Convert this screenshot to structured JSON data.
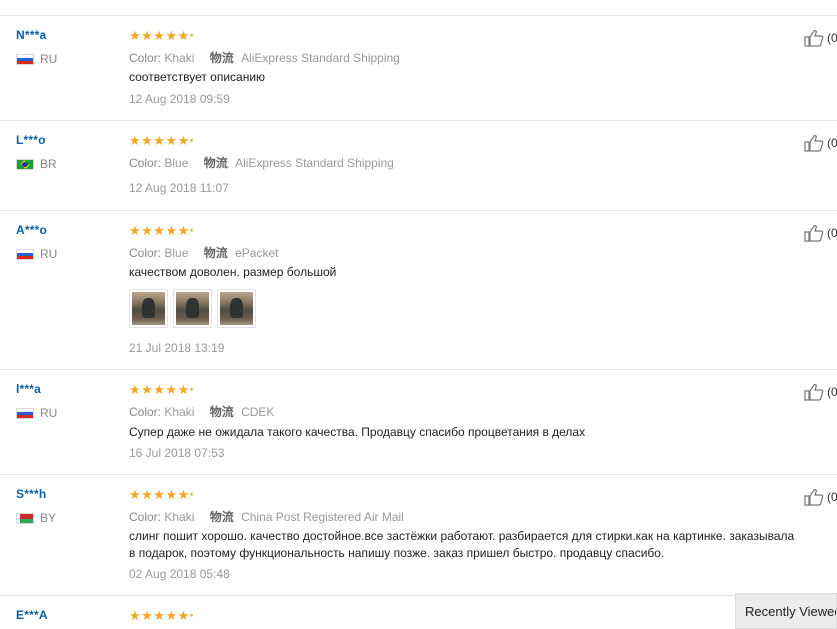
{
  "reviews": [
    {
      "user": "N***a",
      "country": "RU",
      "flag": "ru",
      "stars": "★★★★★",
      "color_label": "Color:",
      "color": "Khaki",
      "logistics_label": "物流",
      "shipping": "AliExpress Standard Shipping",
      "comment": "соответствует описанию",
      "date": "12 Aug 2018 09:59",
      "helpful": "(0"
    },
    {
      "user": "L***o",
      "country": "BR",
      "flag": "br",
      "stars": "★★★★★",
      "color_label": "Color:",
      "color": "Blue",
      "logistics_label": "物流",
      "shipping": "AliExpress Standard Shipping",
      "comment": "",
      "date": "12 Aug 2018 11:07",
      "helpful": "(0"
    },
    {
      "user": "A***o",
      "country": "RU",
      "flag": "ru",
      "stars": "★★★★★",
      "color_label": "Color:",
      "color": "Blue",
      "logistics_label": "物流",
      "shipping": "ePacket",
      "comment": "качеством доволен. размер большой",
      "photo_count": 3,
      "date": "21 Jul 2018 13:19",
      "helpful": "(0"
    },
    {
      "user": "l***a",
      "country": "RU",
      "flag": "ru",
      "stars": "★★★★★",
      "color_label": "Color:",
      "color": "Khaki",
      "logistics_label": "物流",
      "shipping": "CDEK",
      "comment": "Супер даже не ожидала такого качества. Продавцу спасибо процветания в делах",
      "date": "16 Jul 2018 07:53",
      "helpful": "(0"
    },
    {
      "user": "S***h",
      "country": "BY",
      "flag": "by",
      "stars": "★★★★★",
      "color_label": "Color:",
      "color": "Khaki",
      "logistics_label": "物流",
      "shipping": "China Post Registered Air Mail",
      "comment": "слинг пошит хорошо. качество достойное.все застёжки работают. разбирается для стирки.как на картинке. заказывала",
      "comment_line2": "в подарок, поэтому функциональность напишу позже. заказ пришел быстро. продавцу спасибо.",
      "date": "02 Aug 2018 05:48",
      "helpful": "(0"
    },
    {
      "user": "E***A",
      "stars": "★★★★★"
    }
  ],
  "recently_viewed": "Recently Viewed",
  "colors": {
    "star": "#f5a623",
    "username": "#0b5fa5",
    "muted": "#999999"
  },
  "icons": {
    "helpful": "thumbs-up-icon",
    "flag": "country-flag-icon"
  }
}
